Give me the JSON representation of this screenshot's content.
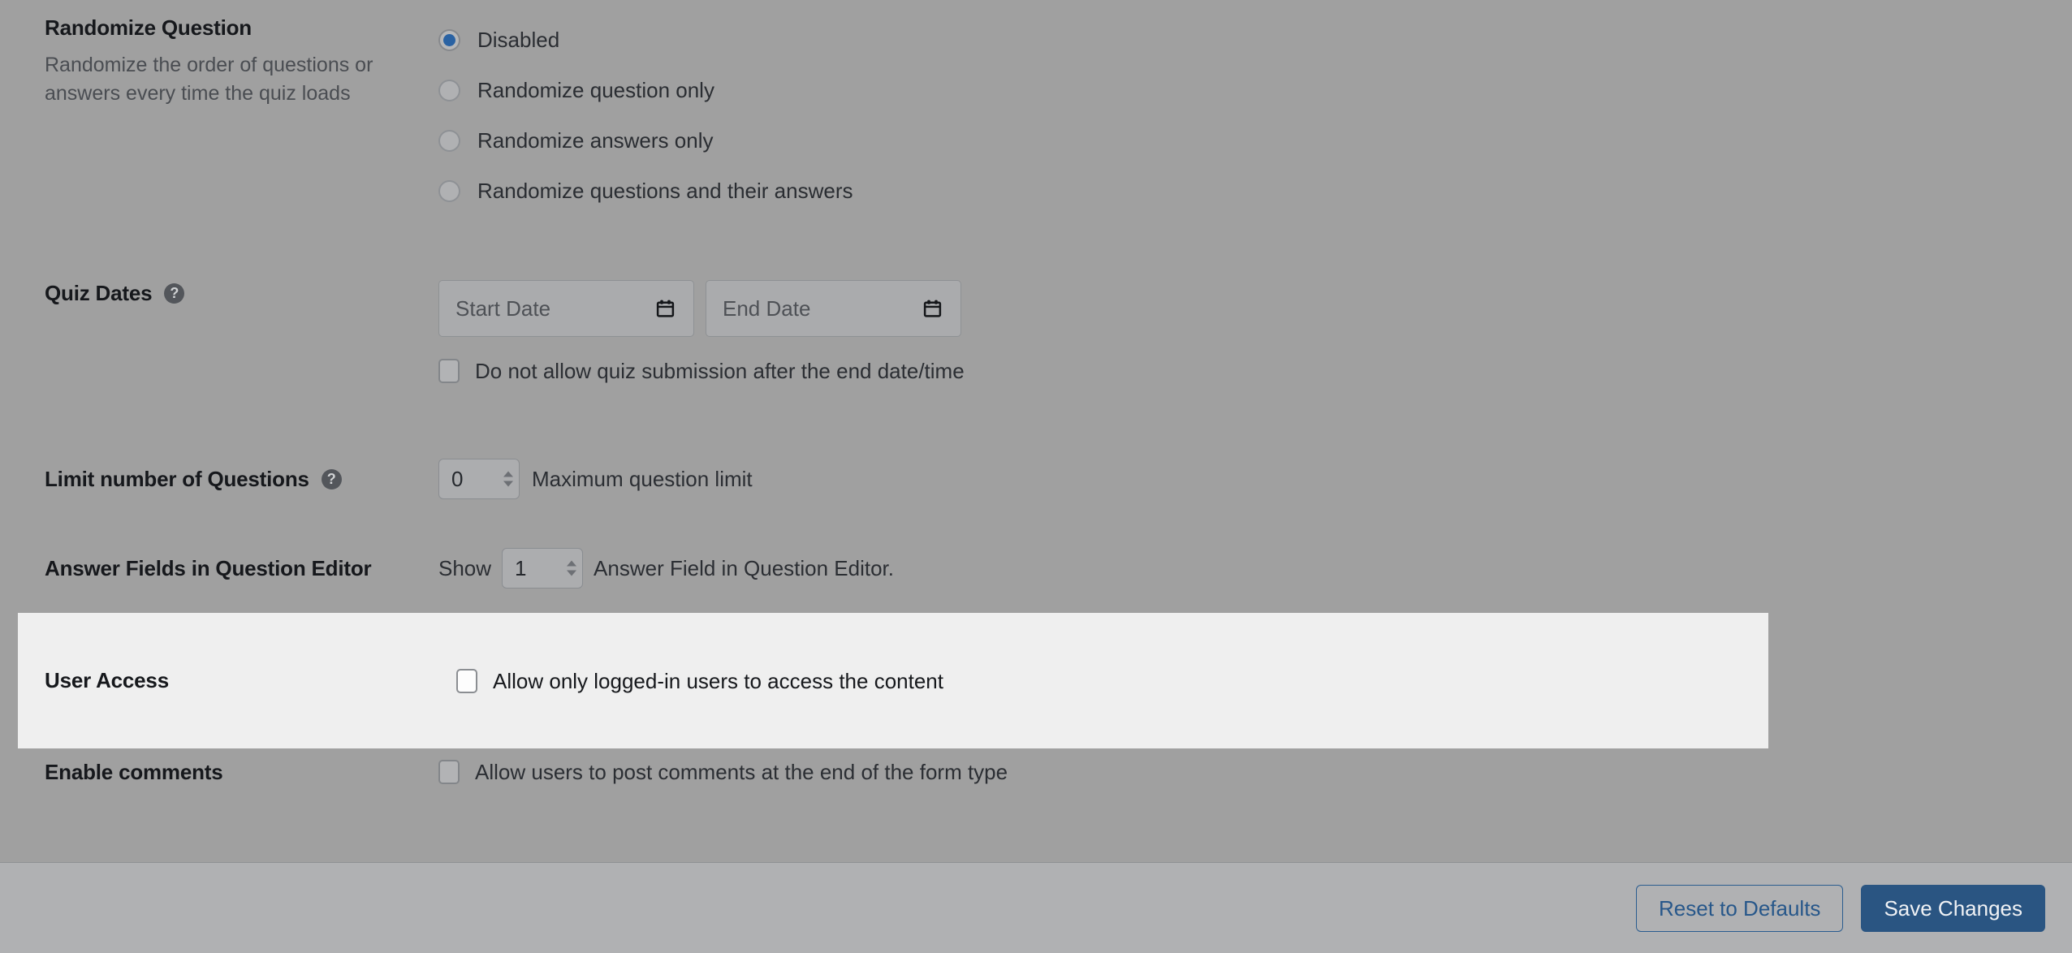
{
  "settings": {
    "randomize_question": {
      "title": "Randomize Question",
      "description": "Randomize the order of questions or answers every time the quiz loads",
      "options": [
        {
          "label": "Disabled",
          "checked": true
        },
        {
          "label": "Randomize question only",
          "checked": false
        },
        {
          "label": "Randomize answers only",
          "checked": false
        },
        {
          "label": "Randomize questions and their answers",
          "checked": false
        }
      ]
    },
    "quiz_dates": {
      "title": "Quiz Dates",
      "help_icon": "help-circle-icon",
      "start_date_placeholder": "Start Date",
      "end_date_placeholder": "End Date",
      "start_calendar_icon": "calendar-icon",
      "end_calendar_icon": "calendar-icon",
      "checkbox_label": "Do not allow quiz submission after the end date/time",
      "checkbox_checked": false
    },
    "limit_questions": {
      "title": "Limit number of Questions",
      "help_icon": "help-circle-icon",
      "value": "0",
      "suffix_text": "Maximum question limit"
    },
    "answer_fields": {
      "title": "Answer Fields in Question Editor",
      "prefix_text": "Show",
      "value": "1",
      "suffix_text": "Answer Field in Question Editor."
    },
    "user_access": {
      "title": "User Access",
      "checkbox_label": "Allow only logged-in users to access the content",
      "checkbox_checked": false
    },
    "enable_comments": {
      "title": "Enable comments",
      "checkbox_label": "Allow users to post comments at the end of the form type",
      "checkbox_checked": false
    }
  },
  "footer": {
    "reset_label": "Reset to Defaults",
    "save_label": "Save Changes"
  },
  "colors": {
    "page_background": "#a0a0a0",
    "highlight_background": "#efefef",
    "footer_background": "#b0b1b3",
    "accent_blue": "#2a5582",
    "radio_selected": "#2a62a3"
  }
}
